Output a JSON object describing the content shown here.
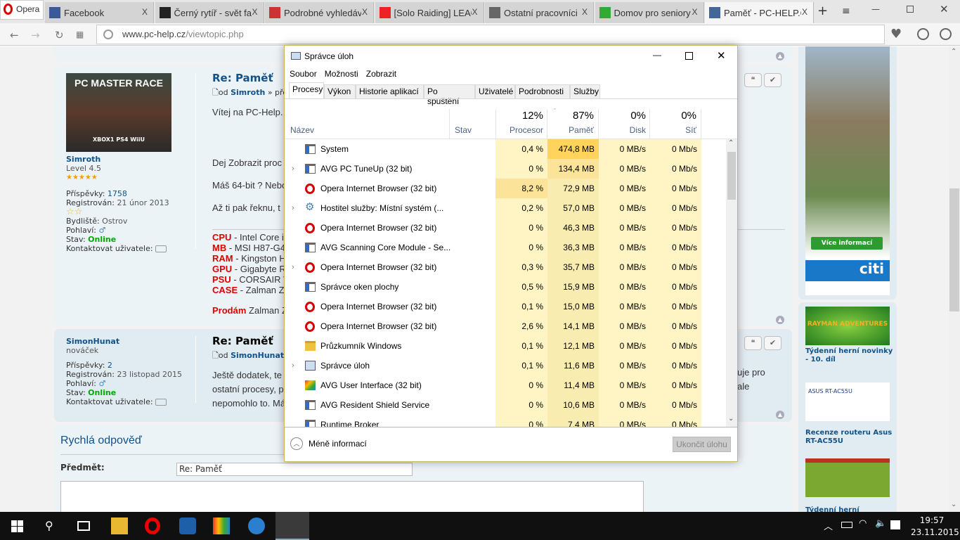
{
  "browser": {
    "menu_label": "Opera",
    "tabs": [
      {
        "title": "Facebook",
        "close": "X"
      },
      {
        "title": "Černý rytíř - svět fantasy",
        "close": "X"
      },
      {
        "title": "Podrobné vyhledávání",
        "close": "X"
      },
      {
        "title": "[Solo Raiding] LEAGUE",
        "close": "X"
      },
      {
        "title": "Ostatní pracovníci",
        "close": "X"
      },
      {
        "title": "Domov pro seniory",
        "close": "X"
      },
      {
        "title": "Paměť - PC-HELP.CZ",
        "close": "X"
      }
    ],
    "new_tab": "+",
    "url_domain": "www.pc-help.cz",
    "url_path": "/viewtopic.php"
  },
  "forum": {
    "posts": [
      {
        "author": "Simroth",
        "rank": "Level 4.5",
        "posts_label": "Příspěvky:",
        "posts": "1758",
        "reg_label": "Registrován:",
        "registered": "21 únor 2013",
        "loc_label": "Bydliště:",
        "location": "Ostrov",
        "gender_label": "Pohlaví:",
        "gender": "♂",
        "status_label": "Stav:",
        "status": "Online",
        "contact_label": "Kontaktovat uživatele:",
        "avatar_top": "PC MASTER RACE",
        "avatar_bottom": "XBOX1 PS4 WiiU",
        "title": "Re: Paměť",
        "by": "od",
        "by_author": "Simroth",
        "by_rest": "» pře",
        "lines": [
          "Vítej na PC-Help.",
          "Dej Zobrazit proc",
          "Máš 64-bit ? Nebo",
          "Až ti pak řeknu, t"
        ],
        "sig": [
          {
            "k": "CPU",
            "v": " - Intel Core i"
          },
          {
            "k": "MB",
            "v": " - MSI H87-G4"
          },
          {
            "k": "RAM",
            "v": " - Kingston H"
          },
          {
            "k": "GPU",
            "v": " - Gigabyte R"
          },
          {
            "k": "PSU",
            "v": " - CORSAIR V"
          },
          {
            "k": "CASE",
            "v": " - Zalman Z"
          }
        ],
        "sell_k": "Prodám",
        "sell_v": " Zalman Z"
      },
      {
        "author": "SimonHunat",
        "rank": "nováček",
        "posts_label": "Příspěvky:",
        "posts": "2",
        "reg_label": "Registrován:",
        "registered": "23 listopad 2015",
        "gender_label": "Pohlaví:",
        "gender": "♂",
        "status_label": "Stav:",
        "status": "Online",
        "contact_label": "Kontaktovat uživatele:",
        "title": "Re: Paměť",
        "by": "od",
        "by_author": "SimonHunat",
        "lines": [
          "Ještě dodatek, te",
          "ostatní procesy, p",
          "nepomohlo to. Má"
        ],
        "right_lines": [
          "uje pro",
          "ale"
        ]
      }
    ],
    "quick_reply": {
      "title": "Rychlá odpověď",
      "subject_label": "Předmět:",
      "subject_value": "Re: Paměť"
    },
    "quote_icon": "❝",
    "check_icon": "✔"
  },
  "sidebar": {
    "ad_button": "Více informací",
    "ad_brand": "citi",
    "articles": [
      {
        "img": "RAYMAN ADVENTURES",
        "title": "Týdenní herní novinky - 10. díl"
      },
      {
        "img": "ASUS RT-AC55U",
        "title": "Recenze routeru Asus RT-AC55U"
      },
      {
        "img": "",
        "title": "Týdenní herní"
      }
    ]
  },
  "taskmgr": {
    "title": "Správce úloh",
    "menu": [
      "Soubor",
      "Možnosti",
      "Zobrazit"
    ],
    "tabs": [
      "Procesy",
      "Výkon",
      "Historie aplikací",
      "Po spuštění",
      "Uživatelé",
      "Podrobnosti",
      "Služby"
    ],
    "columns": {
      "name": "Název",
      "status": "Stav",
      "cpu_pct": "12%",
      "cpu": "Procesor",
      "mem_pct": "87%",
      "mem": "Paměť",
      "disk_pct": "0%",
      "disk": "Disk",
      "net_pct": "0%",
      "net": "Síť"
    },
    "processes": [
      {
        "name": "System",
        "cpu": "0,4 %",
        "mem": "474,8 MB",
        "disk": "0 MB/s",
        "net": "0 Mb/s",
        "exp": false,
        "icon": "window"
      },
      {
        "name": "AVG PC TuneUp (32 bit)",
        "cpu": "0 %",
        "mem": "134,4 MB",
        "disk": "0 MB/s",
        "net": "0 Mb/s",
        "exp": true,
        "icon": "window"
      },
      {
        "name": "Opera Internet Browser (32 bit)",
        "cpu": "8,2 %",
        "mem": "72,9 MB",
        "disk": "0 MB/s",
        "net": "0 Mb/s",
        "exp": false,
        "icon": "opera"
      },
      {
        "name": "Hostitel služby: Místní systém (...",
        "cpu": "0,2 %",
        "mem": "57,0 MB",
        "disk": "0 MB/s",
        "net": "0 Mb/s",
        "exp": true,
        "icon": "gear"
      },
      {
        "name": "Opera Internet Browser (32 bit)",
        "cpu": "0 %",
        "mem": "46,3 MB",
        "disk": "0 MB/s",
        "net": "0 Mb/s",
        "exp": false,
        "icon": "opera"
      },
      {
        "name": "AVG Scanning Core Module - Se...",
        "cpu": "0 %",
        "mem": "36,3 MB",
        "disk": "0 MB/s",
        "net": "0 Mb/s",
        "exp": false,
        "icon": "window"
      },
      {
        "name": "Opera Internet Browser (32 bit)",
        "cpu": "0,3 %",
        "mem": "35,7 MB",
        "disk": "0 MB/s",
        "net": "0 Mb/s",
        "exp": true,
        "icon": "opera"
      },
      {
        "name": "Správce oken plochy",
        "cpu": "0,5 %",
        "mem": "15,9 MB",
        "disk": "0 MB/s",
        "net": "0 Mb/s",
        "exp": false,
        "icon": "window"
      },
      {
        "name": "Opera Internet Browser (32 bit)",
        "cpu": "0,1 %",
        "mem": "15,0 MB",
        "disk": "0 MB/s",
        "net": "0 Mb/s",
        "exp": false,
        "icon": "opera"
      },
      {
        "name": "Opera Internet Browser (32 bit)",
        "cpu": "2,6 %",
        "mem": "14,1 MB",
        "disk": "0 MB/s",
        "net": "0 Mb/s",
        "exp": false,
        "icon": "opera"
      },
      {
        "name": "Průzkumník Windows",
        "cpu": "0,1 %",
        "mem": "12,1 MB",
        "disk": "0 MB/s",
        "net": "0 Mb/s",
        "exp": false,
        "icon": "folder"
      },
      {
        "name": "Správce úloh",
        "cpu": "0,1 %",
        "mem": "11,6 MB",
        "disk": "0 MB/s",
        "net": "0 Mb/s",
        "exp": true,
        "icon": "taskmgr"
      },
      {
        "name": "AVG User Interface (32 bit)",
        "cpu": "0 %",
        "mem": "11,4 MB",
        "disk": "0 MB/s",
        "net": "0 Mb/s",
        "exp": false,
        "icon": "avg"
      },
      {
        "name": "AVG Resident Shield Service",
        "cpu": "0 %",
        "mem": "10,6 MB",
        "disk": "0 MB/s",
        "net": "0 Mb/s",
        "exp": false,
        "icon": "window"
      },
      {
        "name": "Runtime Broker",
        "cpu": "0 %",
        "mem": "7,4 MB",
        "disk": "0 MB/s",
        "net": "0 Mb/s",
        "exp": false,
        "icon": "window"
      }
    ],
    "fewer_details": "Méně informací",
    "end_task": "Ukončit úlohu"
  },
  "taskbar": {
    "time": "19:57",
    "date": "23.11.2015"
  }
}
